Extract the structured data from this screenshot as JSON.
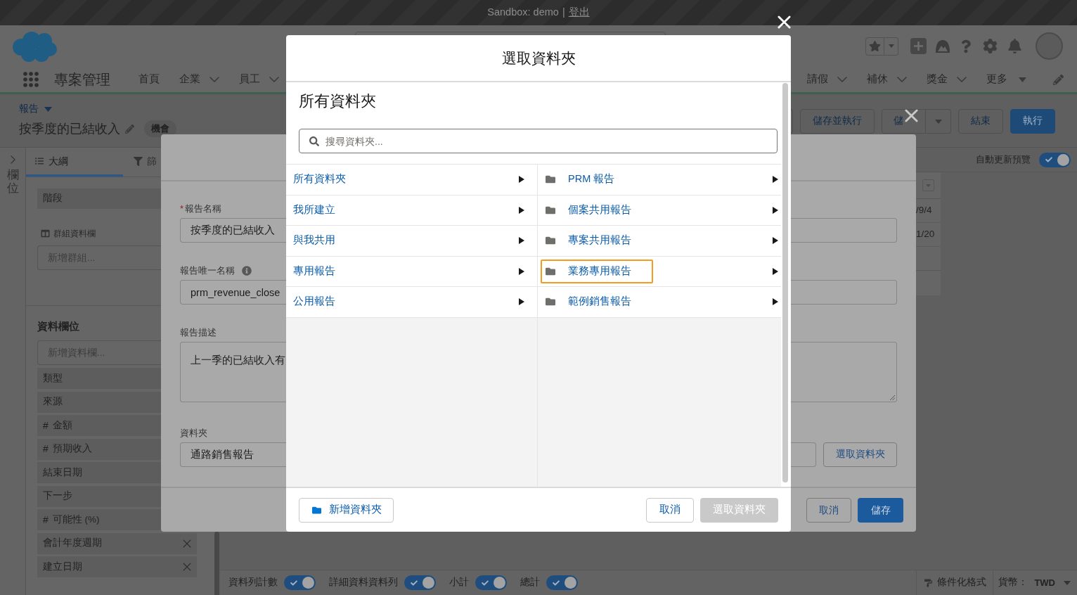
{
  "sandbox_bar": {
    "text": "Sandbox: demo",
    "separator": "|",
    "logout": "登出"
  },
  "nav": {
    "app_name": "專案管理",
    "left_items": [
      {
        "label": "首頁",
        "kind": "link"
      },
      {
        "label": "企業",
        "kind": "menu"
      },
      {
        "label": "員工",
        "kind": "menu"
      }
    ],
    "right_items": [
      {
        "label": "請假",
        "kind": "menu"
      },
      {
        "label": "補休",
        "kind": "menu"
      },
      {
        "label": "獎金",
        "kind": "menu"
      },
      {
        "label": "更多",
        "kind": "more"
      }
    ]
  },
  "report_header": {
    "breadcrumb": "報告",
    "title": "按季度的已結收入",
    "object_type": "機會",
    "buttons": [
      {
        "label": "儲存並執行",
        "kind": "outline"
      },
      {
        "label": "儲",
        "kind": "split"
      },
      {
        "label": "結束",
        "kind": "outline"
      },
      {
        "label": "執行",
        "kind": "brand"
      }
    ]
  },
  "field_strip": {
    "label": "欄位"
  },
  "side_panel": {
    "tabs": [
      {
        "label": "大綱",
        "kind": "outline",
        "selected": true
      },
      {
        "label": "篩",
        "kind": "filters",
        "selected": false
      }
    ],
    "stage_row": "階段",
    "groups": {
      "title": "群組資料欄",
      "placeholder": "新增群組..."
    },
    "columns": {
      "title": "資料欄位",
      "placeholder": "新增資料欄...",
      "items": [
        {
          "label": "類型"
        },
        {
          "label": "來源"
        },
        {
          "type_mark": "#",
          "label": "金額"
        },
        {
          "type_mark": "#",
          "label": "預期收入"
        },
        {
          "label": "結束日期"
        },
        {
          "label": "下一步"
        },
        {
          "type_mark": "#",
          "label": "可能性 (%)"
        },
        {
          "label": "會計年度週期",
          "removable": true
        },
        {
          "label": "建立日期",
          "removable": true
        }
      ]
    }
  },
  "preview_bar": {
    "label": "自動更新預覽",
    "on": true
  },
  "table_fragment": {
    "cells": [
      "/9/4",
      "1/20"
    ]
  },
  "footer_bar": {
    "toggles": [
      {
        "label": "資料列計數",
        "on": true
      },
      {
        "label": "詳細資料資料列",
        "on": true
      },
      {
        "label": "小計",
        "on": true
      },
      {
        "label": "總計",
        "on": true
      }
    ],
    "conditional_formatting": "條件化格式",
    "currency_label": "貨幣：",
    "currency_value": "TWD"
  },
  "save_dialog": {
    "fields": [
      {
        "kind": "text",
        "required_mark": "*",
        "label": "報告名稱",
        "help": false,
        "value": "按季度的已結收入"
      },
      {
        "kind": "text",
        "label": "報告唯一名稱",
        "help": true,
        "value": "prm_revenue_close"
      },
      {
        "kind": "textarea",
        "label": "報告描述",
        "help": false,
        "value": "上一季的已結收入有"
      },
      {
        "kind": "folder",
        "label": "資料夾",
        "help": false,
        "value": "通路銷售報告",
        "button": "選取資料夾"
      }
    ],
    "buttons": [
      {
        "label": "取消",
        "kind": "neutral"
      },
      {
        "label": "儲存",
        "kind": "brand"
      }
    ]
  },
  "folder_dialog": {
    "title": "選取資料夾",
    "heading": "所有資料夾",
    "search": {
      "placeholder": "搜尋資料夾..."
    },
    "categories": [
      "所有資料夾",
      "我所建立",
      "與我共用",
      "專用報告",
      "公用報告"
    ],
    "folders": [
      {
        "label": "PRM 報告",
        "highlighted": false
      },
      {
        "label": "個案共用報告",
        "highlighted": false
      },
      {
        "label": "專案共用報告",
        "highlighted": false
      },
      {
        "label": "業務專用報告",
        "highlighted": true
      },
      {
        "label": "範例銷售報告",
        "highlighted": false
      }
    ],
    "new_folder": "新增資料夾",
    "buttons": [
      {
        "label": "取消",
        "kind": "neutral",
        "disabled": false
      },
      {
        "label": "選取資料夾",
        "kind": "brand",
        "disabled": true
      }
    ]
  }
}
